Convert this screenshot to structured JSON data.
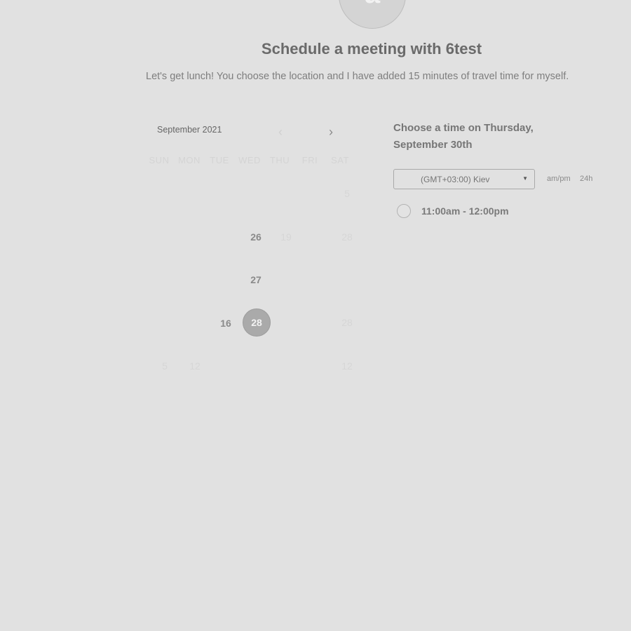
{
  "header": {
    "avatar_letter": "a",
    "title": "Schedule a meeting with 6test",
    "subtitle": "Let's get lunch! You choose the location and I have added 15 minutes of travel time for myself."
  },
  "calendar": {
    "month_label": "September 2021",
    "prev_icon": "chevron-left-icon",
    "next_icon": "chevron-right-icon",
    "weekdays": [
      "SUN",
      "MON",
      "TUE",
      "WED",
      "THU",
      "FRI",
      "SAT"
    ],
    "days": [
      {
        "label": "5",
        "state": "disabled"
      },
      {
        "label": "26",
        "state": "available"
      },
      {
        "label": "19",
        "state": "disabled"
      },
      {
        "label": "28",
        "state": "disabled"
      },
      {
        "label": "27",
        "state": "available"
      },
      {
        "label": "16",
        "state": "available"
      },
      {
        "label": "28",
        "state": "selected"
      },
      {
        "label": "28",
        "state": "disabled"
      },
      {
        "label": "5",
        "state": "disabled"
      },
      {
        "label": "12",
        "state": "disabled"
      },
      {
        "label": "12",
        "state": "disabled"
      }
    ]
  },
  "times": {
    "heading": "Choose a time on Thursday, September 30th",
    "timezone": "(GMT+03:00) Kiev",
    "format_ampm": "am/pm",
    "format_24h": "24h",
    "slots": [
      {
        "label": "11:00am - 12:00pm"
      }
    ]
  },
  "colors": {
    "background": "#e1e1e1",
    "selected_day": "#aaaaaa"
  }
}
